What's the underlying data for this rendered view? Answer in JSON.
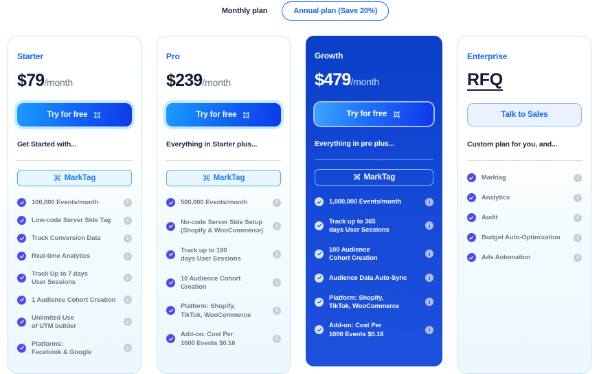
{
  "billing_toggle": {
    "options": [
      {
        "label": "Monthly plan",
        "active": false
      },
      {
        "label": "Annual plan (Save 20%)",
        "active": true
      }
    ]
  },
  "accent": {
    "brand_blue": "#1565ff",
    "featured_bg": "#1448d6",
    "check_purple": "#4b4bf0",
    "card_border": "#bfe7f4"
  },
  "plans": [
    {
      "name": "Starter",
      "price": "$79",
      "period": "/month",
      "cta_label": "Try for free",
      "cta_icon": "target-icon",
      "subtitle": "Get Started with...",
      "marktag_label": "MarkTag",
      "marktag_icon": "command-icon",
      "features": [
        "100,000 Events/month",
        "Low-code Server Side Tag",
        "Track Conversion Data",
        "Real-time Analytics",
        "Track Up to 7 days\nUser Sessions",
        "1 Audience Cohort Creation",
        "Unlimited Use\nof UTM builder",
        "Platforms:\nFacebook & Google"
      ]
    },
    {
      "name": "Pro",
      "price": "$239",
      "period": "/month",
      "cta_label": "Try for free",
      "cta_icon": "target-icon",
      "subtitle": "Everything in Starter plus...",
      "marktag_label": "MarkTag",
      "marktag_icon": "command-icon",
      "features": [
        "500,000 Events/month",
        "No-code Server Side Setup\n(Shopify & WooCommerce)",
        "Track up to 180\ndays User Sessions",
        "10 Audience Cohort Creation",
        "Platform: Shopify,\nTikTok, WooCommerce",
        "Add-on: Cost Per\n1000 Events $0.16"
      ]
    },
    {
      "name": "Growth",
      "price": "$479",
      "period": "/month",
      "cta_label": "Try for free",
      "cta_icon": "target-icon",
      "subtitle": "Everything in pro plus...",
      "marktag_label": "MarkTag",
      "marktag_icon": "command-icon",
      "featured": true,
      "features": [
        "1,000,000 Events/month",
        "Track up to 365\ndays User Sessions",
        "100 Audience\nCohort Creation",
        "Audience Data Auto-Sync",
        "Platform: Shopify,\nTikTok, WooCommerce",
        "Add-on: Cost Per\n1000 Events $0.16"
      ]
    },
    {
      "name": "Enterprise",
      "price": "RFQ",
      "period": "",
      "cta_label": "Talk to Sales",
      "cta_icon": "",
      "subtitle": "Custom plan for you, and...",
      "marktag_label": "",
      "marktag_icon": "",
      "features": [
        "Marktag",
        "Analytics",
        "Audit",
        "Budget Auto-Optimization",
        "Ads Automation"
      ]
    }
  ]
}
